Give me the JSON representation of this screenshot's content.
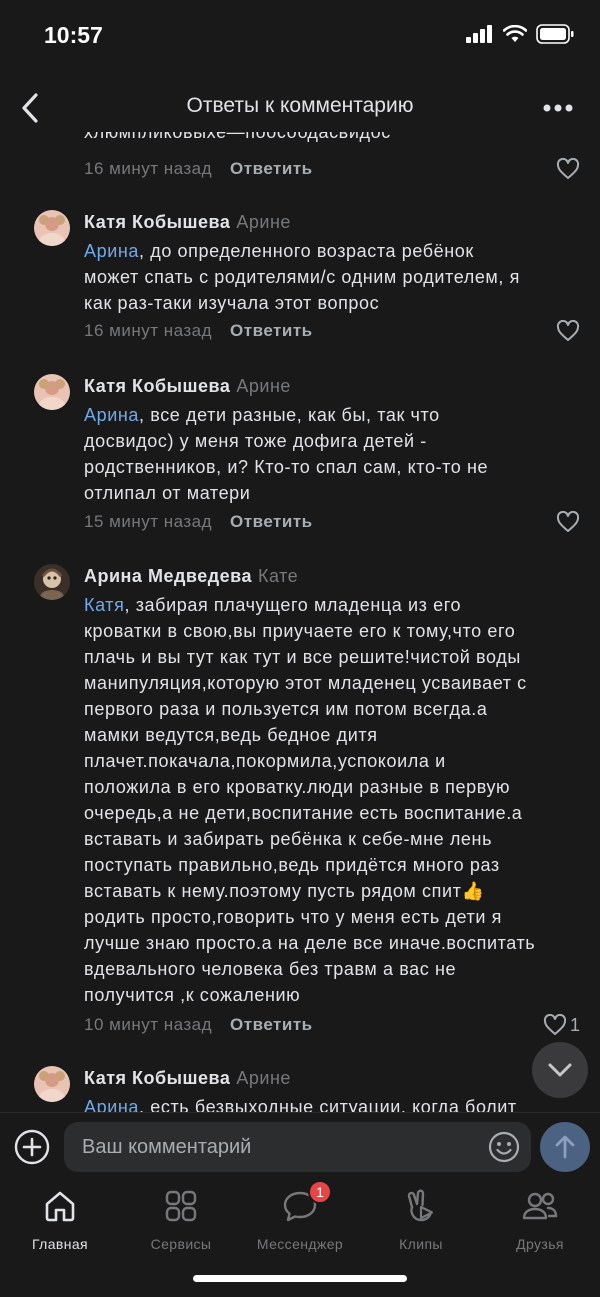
{
  "status": {
    "time": "10:57"
  },
  "header": {
    "title": "Ответы к комментарию"
  },
  "prev_comment": {
    "cut_text": "хлюмпликовыхе—поособдасвидос",
    "time": "16 минут назад",
    "reply": "Ответить"
  },
  "comments": [
    {
      "author": "Катя Кобышева",
      "to": "Арине",
      "mention": "Арина",
      "text": ", до определенного возраста ребёнок\nможет спать с родителями/с одним родителем,  я\nкак раз-таки изучала этот вопрос",
      "time": "16 минут назад",
      "reply": "Ответить",
      "likes": ""
    },
    {
      "author": "Катя Кобышева",
      "to": "Арине",
      "mention": "Арина",
      "text": ", все дети разные, как бы, так что\nдосвидос) у меня тоже дофига детей -\nродственников, и? Кто-то спал сам, кто-то не\nотлипал от матери",
      "time": "15 минут назад",
      "reply": "Ответить",
      "likes": ""
    },
    {
      "author": "Арина Медведева",
      "to": "Кате",
      "mention": "Катя",
      "text": ", забирая плачущего младенца из его\nкроватки в свою,вы приучаете его к тому,что его\nплачь и вы тут как тут и все решите!чистой воды\nманипуляция,которую этот младенец усваивает с\nпервого раза и пользуется им потом всегда.а\nмамки ведутся,ведь бедное дитя\nплачет.покачала,покормила,успокоила и\nположила в его кроватку.люди разные в первую\nочередь,а не дети,воспитание есть воспитание.а\nвставать и забирать ребёнка к себе-мне лень\nпоступать правильно,ведь придётся много раз\nвставать к нему.поэтому пусть рядом спит👍\nродить просто,говорить что у меня есть дети я\nлучше знаю просто.а на деле все иначе.воспитать\nвдевального человека без травм а вас не\nполучится ,к сожалению",
      "time": "10 минут назад",
      "reply": "Ответить",
      "likes": "1"
    },
    {
      "author": "Катя Кобышева",
      "to": "Арине",
      "mention": "Арина",
      "text": ", есть безвыходные ситуации, когда болит",
      "time": "",
      "reply": "",
      "likes": ""
    }
  ],
  "composer": {
    "placeholder": "Ваш комментарий"
  },
  "tabs": [
    {
      "label": "Главная",
      "icon": "home-icon"
    },
    {
      "label": "Сервисы",
      "icon": "services-icon"
    },
    {
      "label": "Мессенджер",
      "icon": "messenger-icon",
      "badge": "1"
    },
    {
      "label": "Клипы",
      "icon": "clips-icon"
    },
    {
      "label": "Друзья",
      "icon": "friends-icon"
    }
  ],
  "colors": {
    "background": "#19191a",
    "mention": "#71aaeb",
    "muted": "#76787a",
    "badge": "#e64646"
  }
}
